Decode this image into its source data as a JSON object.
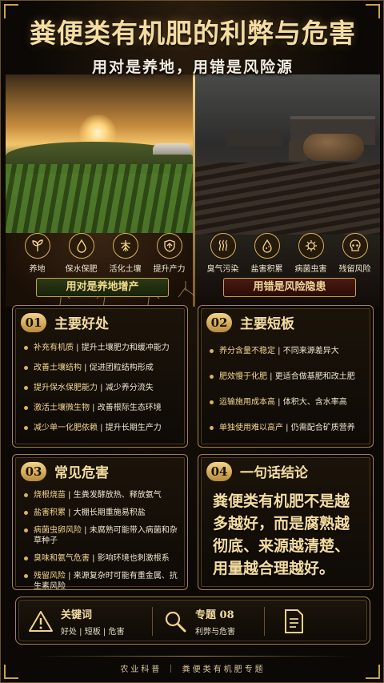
{
  "header": {
    "title": "粪便类有机肥的利弊与危害",
    "subtitle": "用对是养地，用错是风险源"
  },
  "hero": {
    "left_icons": [
      {
        "icon": "seedling-icon",
        "label": "养地"
      },
      {
        "icon": "water-drop-icon",
        "label": "保水保肥"
      },
      {
        "icon": "roots-icon",
        "label": "活化土壤"
      },
      {
        "icon": "shield-up-icon",
        "label": "提升产力"
      }
    ],
    "right_icons": [
      {
        "icon": "odor-icon",
        "label": "臭气污染"
      },
      {
        "icon": "salt-drop-icon",
        "label": "盐害积累"
      },
      {
        "icon": "germ-icon",
        "label": "病菌虫害"
      },
      {
        "icon": "skull-icon",
        "label": "残留风险"
      }
    ],
    "left_banner": "用对是养地增产",
    "right_banner": "用错是风险隐患"
  },
  "card1": {
    "num": "01",
    "title": "主要好处",
    "items": [
      {
        "key": "补充有机质",
        "desc": "提升土壤肥力和缓冲能力"
      },
      {
        "key": "改善土壤结构",
        "desc": "促进团粒结构形成"
      },
      {
        "key": "提升保水保肥能力",
        "desc": "减少养分流失"
      },
      {
        "key": "激活土壤微生物",
        "desc": "改善根际生态环境"
      },
      {
        "key": "减少单一化肥依赖",
        "desc": "提升长期生产力"
      }
    ]
  },
  "card2": {
    "num": "02",
    "title": "主要短板",
    "items": [
      {
        "key": "养分含量不稳定",
        "desc": "不同来源差异大"
      },
      {
        "key": "肥效慢于化肥",
        "desc": "更适合做基肥和改土肥"
      },
      {
        "key": "运输施用成本高",
        "desc": "体积大、含水率高"
      },
      {
        "key": "单独使用难以高产",
        "desc": "仍需配合矿质营养"
      }
    ]
  },
  "card3": {
    "num": "03",
    "title": "常见危害",
    "items": [
      {
        "key": "烧根烧苗",
        "desc": "生粪发酵放热、释放氨气"
      },
      {
        "key": "盐害积累",
        "desc": "大棚长期重施易积盐"
      },
      {
        "key": "病菌虫卵风险",
        "desc": "未腐熟可能带入病菌和杂草种子"
      },
      {
        "key": "臭味和氨气危害",
        "desc": "影响环境也刺激根系"
      },
      {
        "key": "残留风险",
        "desc": "来源复杂时可能有重金属、抗生素风险"
      }
    ]
  },
  "card4": {
    "num": "04",
    "title": "一句话结论",
    "conclusion": "粪便类有机肥不是越多越好，而是腐熟越彻底、来源越清楚、用量越合理越好。"
  },
  "bottom": {
    "keywords_title": "关键词",
    "keywords_sub": "好处 | 短板 | 危害",
    "topic_title": "专题 08",
    "topic_sub": "利弊与危害"
  },
  "footer": "农业科普 ｜ 粪便类有机肥专题",
  "colors": {
    "accent_gold": "#d8b25e",
    "title_gold": "#f4dca2",
    "good_banner": "#2c3a16",
    "bad_banner": "#4a1a12"
  }
}
